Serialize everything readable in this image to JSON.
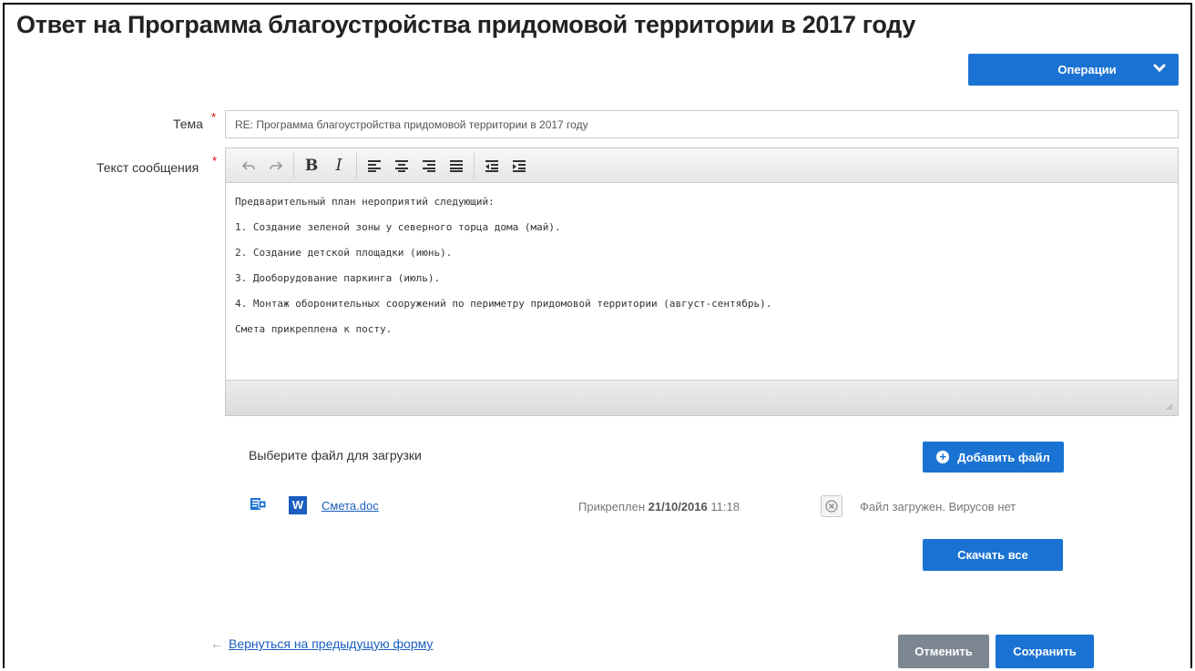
{
  "page": {
    "title": "Ответ на Программа благоустройства придомовой территории в 2017 году"
  },
  "operations": {
    "label": "Операции",
    "icon": "chevron-down-icon"
  },
  "form": {
    "subject_label": "Тема",
    "subject_value": "RE: Программа благоустройства придомовой территории в 2017 году",
    "message_label": "Текст сообщения",
    "required_mark": "*",
    "toolbar": {
      "undo_icon": "undo-icon",
      "redo_icon": "redo-icon",
      "bold_label": "B",
      "italic_label": "I",
      "align_icons": [
        "align-left-icon",
        "align-center-icon",
        "align-right-icon",
        "align-justify-icon"
      ],
      "indent_icons": [
        "outdent-icon",
        "indent-icon"
      ]
    },
    "message_lines": [
      "Предварительный план нероприятий следующий:",
      "1. Создание зеленой зоны у северного торца дома (май).",
      "2. Создание детской площадки (июнь).",
      "3. Дооборудование паркинга (июль).",
      "4. Монтаж оборонительных сооружений по периметру придомовой территории (август-сентябрь).",
      "Смета прикреплена к посту."
    ]
  },
  "upload": {
    "label": "Выберите файл для загрузки",
    "add_button": "Добавить файл",
    "file": {
      "name": "Смета.doc",
      "attached_prefix": "Прикреплен",
      "attached_date": "21/10/2016",
      "attached_time": "11:18",
      "scan_status": "Файл загружен. Вирусов нет"
    },
    "download_all": "Скачать все"
  },
  "footer": {
    "back_link": "Вернуться на предыдущую форму",
    "cancel": "Отменить",
    "save": "Сохранить"
  },
  "colors": {
    "primary": "#1a73d2",
    "secondary": "#7c8791",
    "required": "#dd0000",
    "link": "#1a5ebf"
  }
}
